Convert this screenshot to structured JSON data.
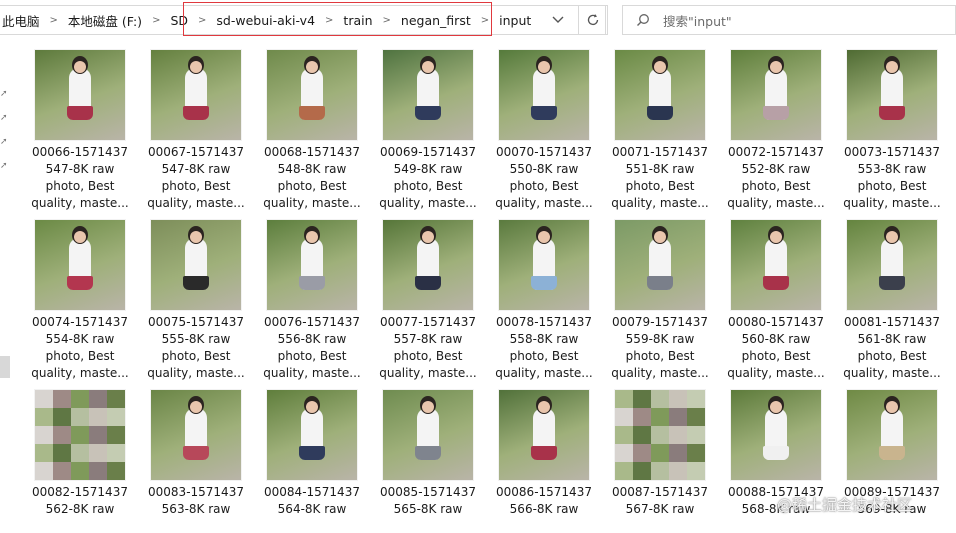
{
  "breadcrumb": [
    "此电脑",
    "本地磁盘 (F:)",
    "SD",
    "sd-webui-aki-v4",
    "train",
    "negan_first",
    "input"
  ],
  "search": {
    "placeholder": "搜索\"input\""
  },
  "files": [
    {
      "l1": "00066-1571437",
      "l2": "547-8K raw",
      "l3": "photo, Best",
      "l4": "quality, maste...",
      "skirt": "#a8324a",
      "bg": "#5d7a3c",
      "pix": false
    },
    {
      "l1": "00067-1571437",
      "l2": "547-8K raw",
      "l3": "photo, Best",
      "l4": "quality, maste...",
      "skirt": "#a8324a",
      "bg": "#64803f",
      "pix": false
    },
    {
      "l1": "00068-1571437",
      "l2": "548-8K raw",
      "l3": "photo, Best",
      "l4": "quality, maste...",
      "skirt": "#b46a4a",
      "bg": "#6f8a4b",
      "pix": false
    },
    {
      "l1": "00069-1571437",
      "l2": "549-8K raw",
      "l3": "photo, Best",
      "l4": "quality, maste...",
      "skirt": "#2f3b5c",
      "bg": "#4f7340",
      "pix": false
    },
    {
      "l1": "00070-1571437",
      "l2": "550-8K raw",
      "l3": "photo, Best",
      "l4": "quality, maste...",
      "skirt": "#2f3b5c",
      "bg": "#557a3b",
      "pix": false
    },
    {
      "l1": "00071-1571437",
      "l2": "551-8K raw",
      "l3": "photo, Best",
      "l4": "quality, maste...",
      "skirt": "#2a3550",
      "bg": "#6a8a45",
      "pix": false
    },
    {
      "l1": "00072-1571437",
      "l2": "552-8K raw",
      "l3": "photo, Best",
      "l4": "quality, maste...",
      "skirt": "#b7a0a6",
      "bg": "#5f7f3c",
      "pix": false
    },
    {
      "l1": "00073-1571437",
      "l2": "553-8K raw",
      "l3": "photo, Best",
      "l4": "quality, maste...",
      "skirt": "#a8324a",
      "bg": "#4f6b33",
      "pix": false
    },
    {
      "l1": "00074-1571437",
      "l2": "554-8K raw",
      "l3": "photo, Best",
      "l4": "quality, maste...",
      "skirt": "#b3364f",
      "bg": "#6b8a45",
      "pix": false
    },
    {
      "l1": "00075-1571437",
      "l2": "555-8K raw",
      "l3": "photo, Best",
      "l4": "quality, maste...",
      "skirt": "#2a2a2a",
      "bg": "#7d8e5a",
      "pix": false
    },
    {
      "l1": "00076-1571437",
      "l2": "556-8K raw",
      "l3": "photo, Best",
      "l4": "quality, maste...",
      "skirt": "#9a9ca6",
      "bg": "#5c7e3d",
      "pix": false
    },
    {
      "l1": "00077-1571437",
      "l2": "557-8K raw",
      "l3": "photo, Best",
      "l4": "quality, maste...",
      "skirt": "#2a3045",
      "bg": "#567639",
      "pix": false
    },
    {
      "l1": "00078-1571437",
      "l2": "558-8K raw",
      "l3": "photo, Best",
      "l4": "quality, maste...",
      "skirt": "#8cb1d6",
      "bg": "#5a7a3e",
      "pix": false
    },
    {
      "l1": "00079-1571437",
      "l2": "559-8K raw",
      "l3": "photo, Best",
      "l4": "quality, maste...",
      "skirt": "#7a7f8a",
      "bg": "#7c9a66",
      "pix": false
    },
    {
      "l1": "00080-1571437",
      "l2": "560-8K raw",
      "l3": "photo, Best",
      "l4": "quality, maste...",
      "skirt": "#a8324a",
      "bg": "#5f813f",
      "pix": false
    },
    {
      "l1": "00081-1571437",
      "l2": "561-8K raw",
      "l3": "photo, Best",
      "l4": "quality, maste...",
      "skirt": "#3b3f4c",
      "bg": "#64843f",
      "pix": false
    },
    {
      "l1": "00082-1571437",
      "l2": "562-8K raw",
      "l3": "",
      "l4": "",
      "skirt": "#a8324a",
      "bg": "#6b7a55",
      "pix": true
    },
    {
      "l1": "00083-1571437",
      "l2": "563-8K raw",
      "l3": "",
      "l4": "",
      "skirt": "#b7485a",
      "bg": "#6a8546",
      "pix": false
    },
    {
      "l1": "00084-1571437",
      "l2": "564-8K raw",
      "l3": "",
      "l4": "",
      "skirt": "#2f3b5c",
      "bg": "#5f7e3c",
      "pix": false
    },
    {
      "l1": "00085-1571437",
      "l2": "565-8K raw",
      "l3": "",
      "l4": "",
      "skirt": "#7f848e",
      "bg": "#6f8c50",
      "pix": false
    },
    {
      "l1": "00086-1571437",
      "l2": "566-8K raw",
      "l3": "",
      "l4": "",
      "skirt": "#a8324a",
      "bg": "#51713a",
      "pix": false
    },
    {
      "l1": "00087-1571437",
      "l2": "567-8K raw",
      "l3": "",
      "l4": "",
      "skirt": "#a8324a",
      "bg": "#8c9c78",
      "pix": true
    },
    {
      "l1": "00088-1571437",
      "l2": "568-8K raw",
      "l3": "",
      "l4": "",
      "skirt": "#f0f0f0",
      "bg": "#5d7b3b",
      "pix": false
    },
    {
      "l1": "00089-1571437",
      "l2": "569-8K raw",
      "l3": "",
      "l4": "",
      "skirt": "#c9b48e",
      "bg": "#6f8a45",
      "pix": false
    }
  ],
  "watermark": "@稀土掘金技术社区",
  "colors": {
    "highlight": "#e0393e",
    "border": "#d9d9d9"
  },
  "icons": {
    "dropdown": "chevron-down-icon",
    "refresh": "refresh-icon",
    "search": "search-icon"
  }
}
